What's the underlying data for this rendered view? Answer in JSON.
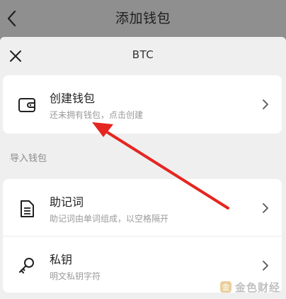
{
  "header": {
    "title": "添加钱包",
    "back_icon": "chevron-left-icon"
  },
  "sheet": {
    "coin": "BTC",
    "close_icon": "close-icon"
  },
  "create_wallet": {
    "label": "创建钱包",
    "description": "还未拥有钱包，点击创建",
    "icon": "wallet-icon"
  },
  "import_section": {
    "title": "导入钱包",
    "items": [
      {
        "label": "助记词",
        "description": "助记词由单词组成，以空格隔开",
        "icon": "document-icon"
      },
      {
        "label": "私钥",
        "description": "明文私钥字符",
        "icon": "key-icon"
      }
    ]
  },
  "annotation": {
    "color": "#e52620"
  },
  "watermark": {
    "text": "金色财经"
  }
}
